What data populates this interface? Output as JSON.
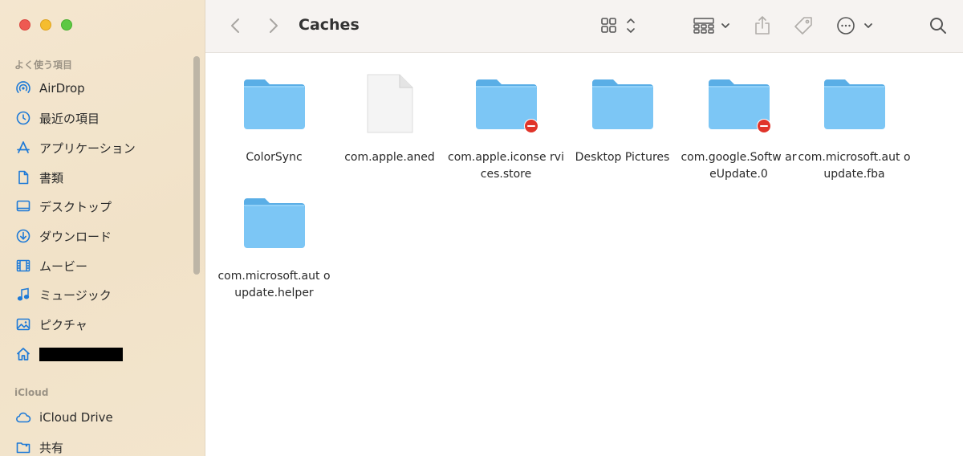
{
  "window": {
    "title": "Caches"
  },
  "sidebar": {
    "favorites_label": "よく使う項目",
    "items": [
      {
        "label": "AirDrop",
        "icon": "airdrop-icon"
      },
      {
        "label": "最近の項目",
        "icon": "clock-icon"
      },
      {
        "label": "アプリケーション",
        "icon": "applications-icon"
      },
      {
        "label": "書類",
        "icon": "document-icon"
      },
      {
        "label": "デスクトップ",
        "icon": "desktop-icon"
      },
      {
        "label": "ダウンロード",
        "icon": "download-icon"
      },
      {
        "label": "ムービー",
        "icon": "film-icon"
      },
      {
        "label": "ミュージック",
        "icon": "music-icon"
      },
      {
        "label": "ピクチャ",
        "icon": "photo-icon"
      },
      {
        "label": "",
        "icon": "home-icon"
      }
    ],
    "icloud_label": "iCloud",
    "icloud_items": [
      {
        "label": "iCloud Drive",
        "icon": "cloud-icon"
      },
      {
        "label": "共有",
        "icon": "shared-folder-icon"
      }
    ]
  },
  "files": [
    {
      "name": "ColorSync",
      "kind": "folder",
      "restricted": false
    },
    {
      "name": "com.apple.aned",
      "kind": "file",
      "restricted": false
    },
    {
      "name": "com.apple.iconse rvices.store",
      "kind": "folder",
      "restricted": true
    },
    {
      "name": "Desktop Pictures",
      "kind": "folder",
      "restricted": false
    },
    {
      "name": "com.google.Softw areUpdate.0",
      "kind": "folder",
      "restricted": true
    },
    {
      "name": "com.microsoft.aut oupdate.fba",
      "kind": "folder",
      "restricted": false
    },
    {
      "name": "com.microsoft.aut oupdate.helper",
      "kind": "folder",
      "restricted": false
    }
  ],
  "colors": {
    "folder_top": "#5fb3ea",
    "folder_body": "#7cc5f4",
    "accent": "#1e7ad7",
    "badge": "#e0342a"
  }
}
